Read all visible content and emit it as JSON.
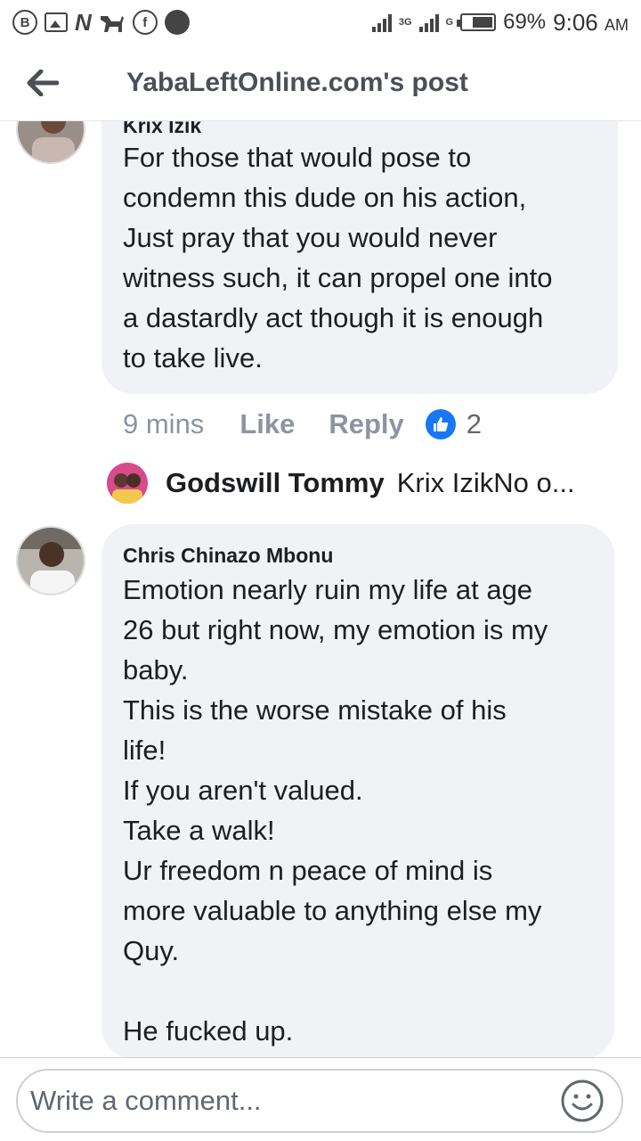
{
  "status_bar": {
    "network_3g": "3G",
    "network_g": "G",
    "battery": "69%",
    "time": "9:06",
    "ampm": "AM"
  },
  "header": {
    "title": "YabaLeftOnline.com's post"
  },
  "comments": [
    {
      "author": "Krix Izik",
      "text": "For those that would pose to\ncondemn this dude on his action,\nJust pray that you would never\nwitness such, it can propel one into\na dastardly act though it is enough\nto take live.",
      "time": "9 mins",
      "like_label": "Like",
      "reply_label": "Reply",
      "reactions": "2",
      "reply_preview": {
        "author": "Godswill Tommy",
        "text": "Krix IzikNo o..."
      }
    },
    {
      "author": "Chris Chinazo Mbonu",
      "text": "Emotion nearly ruin my life at age\n26 but right now, my emotion is my\nbaby.\nThis is the worse mistake of his\nlife!\nIf you aren't valued.\nTake a walk!\nUr freedom n peace of mind is\nmore valuable to anything else my\nQuy.\n\nHe fucked up."
    }
  ],
  "composer": {
    "placeholder": "Write a comment..."
  },
  "colors": {
    "bubble": "#f0f2f5",
    "like_blue": "#1877f2",
    "meta_gray": "#8d949e"
  }
}
